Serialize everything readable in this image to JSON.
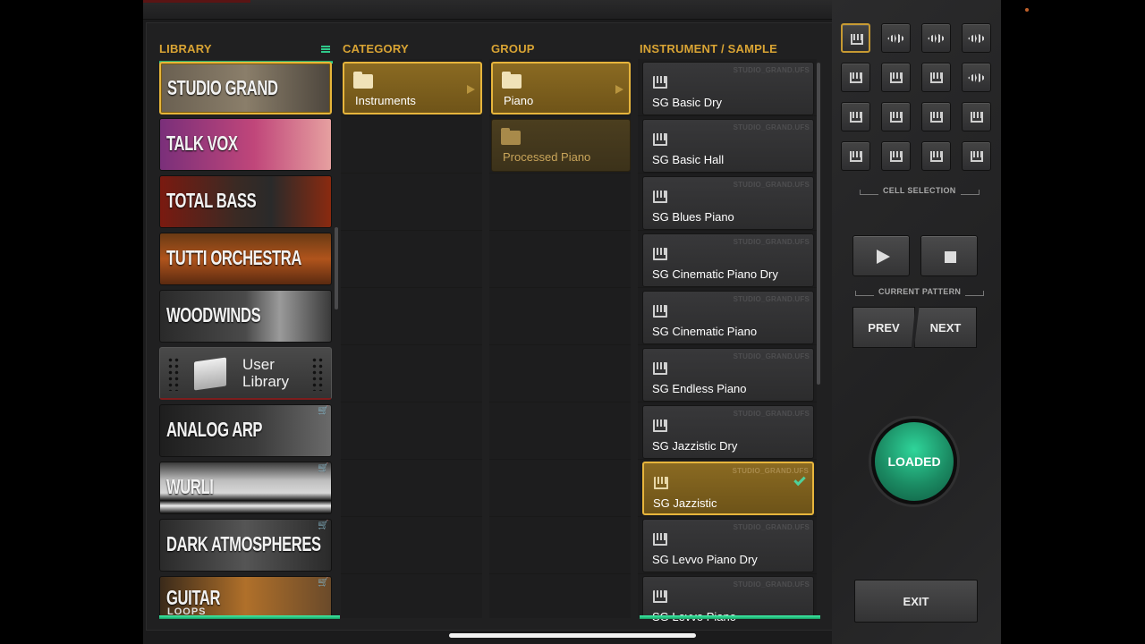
{
  "headers": {
    "library": "LIBRARY",
    "category": "CATEGORY",
    "group": "GROUP",
    "instrument": "INSTRUMENT / SAMPLE"
  },
  "library": {
    "items": [
      {
        "label": "STUDIO GRAND",
        "selected": true
      },
      {
        "label": "TALK VOX"
      },
      {
        "label": "TOTAL BASS"
      },
      {
        "label": "TUTTI ORCHESTRA"
      },
      {
        "label": "WOODWINDS"
      },
      {
        "label": "User Library"
      },
      {
        "label": "ANALOG ARP",
        "store": true
      },
      {
        "label": "WURLI",
        "store": true
      },
      {
        "label": "DARK ATMOSPHERES",
        "store": true
      },
      {
        "label": "GUITAR",
        "sublabel": "LOOPS",
        "store": true
      }
    ],
    "user_line1": "User",
    "user_line2": "Library"
  },
  "category": {
    "items": [
      {
        "label": "Instruments",
        "selected": true
      }
    ]
  },
  "group": {
    "items": [
      {
        "label": "Piano",
        "selected": true
      },
      {
        "label": "Processed Piano"
      }
    ]
  },
  "instruments": {
    "source": "STUDIO_GRAND.UFS",
    "items": [
      {
        "label": "SG Basic Dry"
      },
      {
        "label": "SG Basic Hall"
      },
      {
        "label": "SG Blues Piano"
      },
      {
        "label": "SG Cinematic Piano Dry"
      },
      {
        "label": "SG Cinematic Piano"
      },
      {
        "label": "SG Endless Piano"
      },
      {
        "label": "SG Jazzistic Dry"
      },
      {
        "label": "SG Jazzistic",
        "selected": true
      },
      {
        "label": "SG Levvo Piano Dry"
      },
      {
        "label": "SG Levvo Piano"
      }
    ]
  },
  "cell_selection": {
    "label": "CELL SELECTION",
    "icons": [
      [
        "piano-icon",
        "waveform-icon",
        "waveform-icon",
        "waveform-icon"
      ],
      [
        "piano-icon",
        "piano-icon",
        "piano-icon",
        "waveform-icon"
      ],
      [
        "piano-icon",
        "piano-icon",
        "piano-icon",
        "piano-icon"
      ],
      [
        "piano-icon",
        "piano-icon",
        "piano-icon",
        "piano-icon"
      ]
    ]
  },
  "pattern": {
    "label": "CURRENT PATTERN",
    "prev": "PREV",
    "next": "NEXT"
  },
  "status": "LOADED",
  "exit": "EXIT",
  "colors": {
    "accent_gold": "#e7b53c",
    "accent_green": "#2fd59a",
    "background": "#1b1b1c"
  }
}
